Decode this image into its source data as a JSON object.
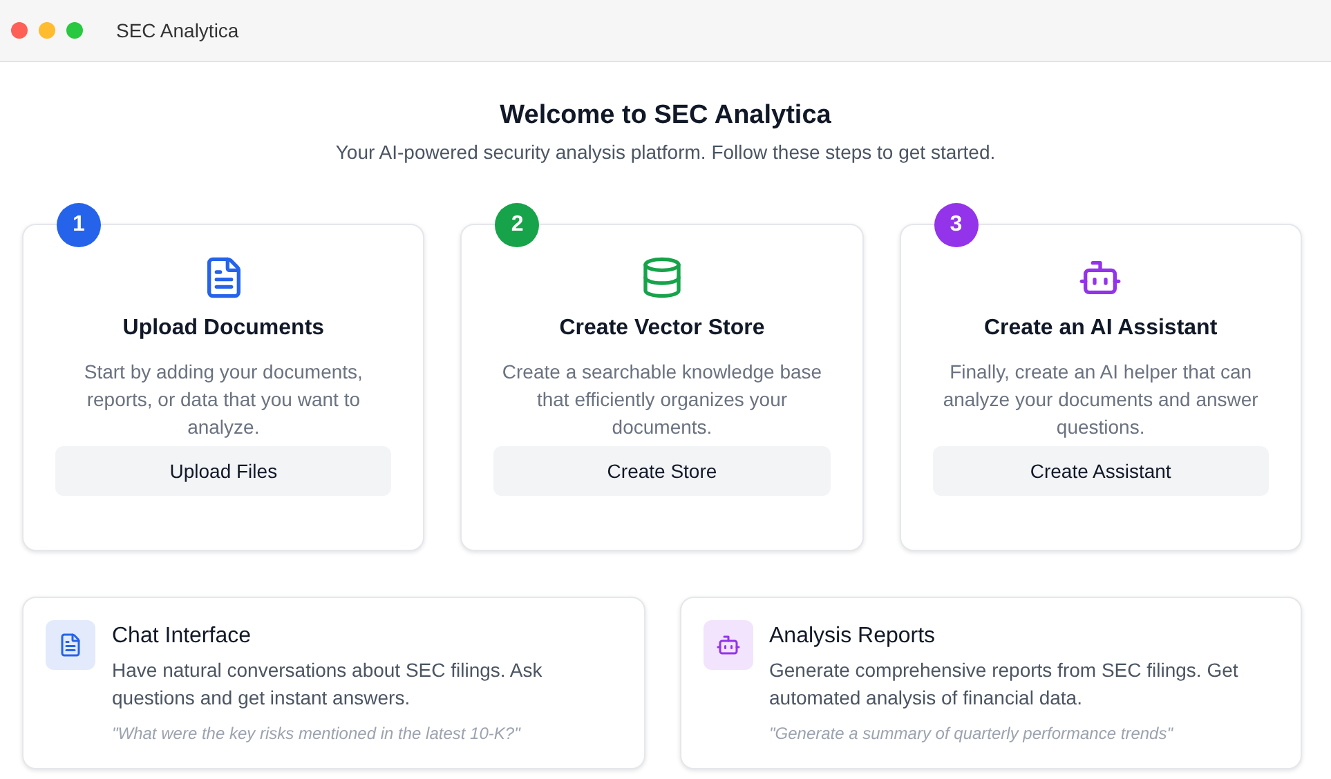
{
  "window": {
    "title": "SEC Analytica"
  },
  "header": {
    "title": "Welcome to SEC Analytica",
    "subtitle": "Your AI-powered security analysis platform. Follow these steps to get started."
  },
  "steps": [
    {
      "number": "1",
      "kind": "document",
      "color": "#2563eb",
      "title": "Upload Documents",
      "description": "Start by adding your documents, reports, or data that you want to analyze.",
      "button": "Upload Files"
    },
    {
      "number": "2",
      "kind": "database",
      "color": "#16a34a",
      "title": "Create Vector Store",
      "description": "Create a searchable knowledge base that efficiently organizes your documents.",
      "button": "Create Store"
    },
    {
      "number": "3",
      "kind": "bot",
      "color": "#9333ea",
      "title": "Create an AI Assistant",
      "description": "Finally, create an AI helper that can analyze your documents and answer questions.",
      "button": "Create Assistant"
    }
  ],
  "features": [
    {
      "kind": "document",
      "color": "#2563eb",
      "title": "Chat Interface",
      "description": "Have natural conversations about SEC filings. Ask questions and get instant answers.",
      "example": "\"What were the key risks mentioned in the latest 10-K?\""
    },
    {
      "kind": "bot",
      "color": "#9333ea",
      "title": "Analysis Reports",
      "description": "Generate comprehensive reports from SEC filings. Get automated analysis of financial data.",
      "example": "\"Generate a summary of quarterly performance trends\""
    }
  ]
}
